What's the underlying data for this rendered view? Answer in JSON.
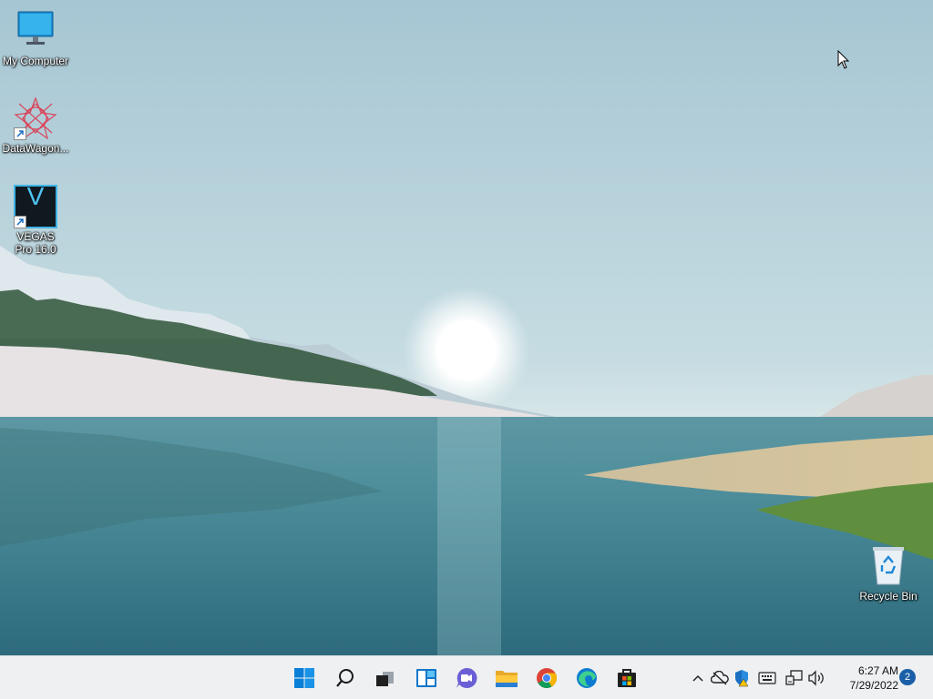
{
  "desktop": {
    "icons": [
      {
        "label": "My Computer",
        "icon": "monitor-icon"
      },
      {
        "label": "DataWagon...",
        "icon": "datawagon-icon"
      },
      {
        "label": "VEGAS Pro 16.0",
        "icon": "vegas-pro-icon",
        "glyph_letter": "V"
      },
      {
        "label": "Recycle Bin",
        "icon": "recycle-bin-icon"
      }
    ]
  },
  "taskbar": {
    "pinned": [
      {
        "name": "Start",
        "icon": "windows-logo-icon"
      },
      {
        "name": "Search",
        "icon": "search-icon"
      },
      {
        "name": "Task View",
        "icon": "task-view-icon"
      },
      {
        "name": "Widgets",
        "icon": "widgets-icon"
      },
      {
        "name": "Chat",
        "icon": "chat-icon"
      },
      {
        "name": "File Explorer",
        "icon": "folder-icon"
      },
      {
        "name": "Google Chrome",
        "icon": "chrome-icon"
      },
      {
        "name": "Microsoft Edge",
        "icon": "edge-icon"
      },
      {
        "name": "Microsoft Store",
        "icon": "store-icon"
      }
    ],
    "tray": {
      "icons": [
        "chevron-up-icon",
        "cloud-offline-icon",
        "security-shield-icon",
        "keyboard-icon",
        "network-icon",
        "volume-icon"
      ],
      "time": "6:27 AM",
      "date": "7/29/2022",
      "notification_count": "2"
    }
  },
  "colors": {
    "accent": "#0078d4",
    "taskbar_bg": "#eef0f2"
  }
}
